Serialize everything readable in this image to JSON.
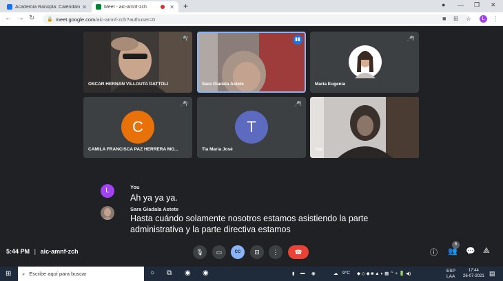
{
  "browser": {
    "tabs": [
      {
        "title": "Academia Ranopla: Calendario -",
        "color": "#1a73e8"
      },
      {
        "title": "Meet - aic-amnf-zch",
        "color": "#00832d"
      }
    ],
    "url_host": "meet.google.com",
    "url_path": "/aic-amnf-zch?authuser=0",
    "profile_initial": "L"
  },
  "participants": [
    {
      "name": "OSCAR HERNAN VILLOUTA DATTOLI",
      "muted": true
    },
    {
      "name": "Sara Giadala Astete",
      "speaking": true
    },
    {
      "name": "Maria Eugenia",
      "muted": true
    },
    {
      "name": "CAMILA FRANCISCA PAZ HERRERA MO...",
      "muted": true,
      "initial": "C",
      "avatar_color": "#e8710a"
    },
    {
      "name": "Tia Maria José",
      "muted": true,
      "initial": "T",
      "avatar_color": "#5c6bc0"
    },
    {
      "name": "You"
    }
  ],
  "captions": [
    {
      "speaker": "You",
      "initial": "L",
      "avatar_color": "#a142f4",
      "lines": [
        "Ah ya ya ya."
      ]
    },
    {
      "speaker": "Sara Giadala Astete",
      "lines": [
        "Hasta cuándo solamente nosotros estamos asistiendo la parte",
        "administrativa y la parte directiva estamos"
      ]
    }
  ],
  "meeting": {
    "time": "5:44 PM",
    "code": "aic-amnf-zch",
    "participant_count": "6",
    "cc_label": "CC"
  },
  "taskbar": {
    "search_placeholder": "Escribe aquí para buscar",
    "temperature": "9°C",
    "language": "ESP",
    "language_sub": "LAA",
    "time": "17:44",
    "date": "26-07-2021"
  }
}
